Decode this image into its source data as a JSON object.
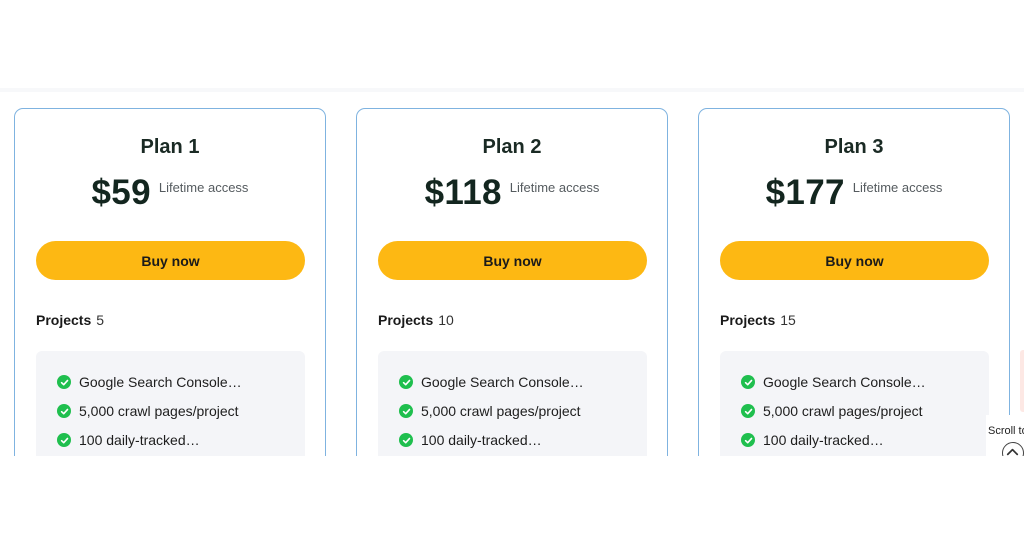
{
  "plans": [
    {
      "name": "Plan 1",
      "price": "$59",
      "price_note": "Lifetime access",
      "button_label": "Buy now",
      "projects_label": "Projects",
      "projects_value": "5",
      "features": [
        "Google Search Console…",
        "5,000 crawl pages/project",
        "100 daily-tracked…"
      ]
    },
    {
      "name": "Plan 2",
      "price": "$118",
      "price_note": "Lifetime access",
      "button_label": "Buy now",
      "projects_label": "Projects",
      "projects_value": "10",
      "features": [
        "Google Search Console…",
        "5,000 crawl pages/project",
        "100 daily-tracked…"
      ]
    },
    {
      "name": "Plan 3",
      "price": "$177",
      "price_note": "Lifetime access",
      "button_label": "Buy now",
      "projects_label": "Projects",
      "projects_value": "15",
      "features": [
        "Google Search Console…",
        "5,000 crawl pages/project",
        "100 daily-tracked…"
      ]
    }
  ],
  "scroll_widget": {
    "label": "Scroll to",
    "icon": "chevron-up-icon"
  },
  "colors": {
    "card_border": "#7fb3e0",
    "button": "#fdb813",
    "check": "#1fbf4e",
    "features_bg": "#f4f5f8"
  }
}
